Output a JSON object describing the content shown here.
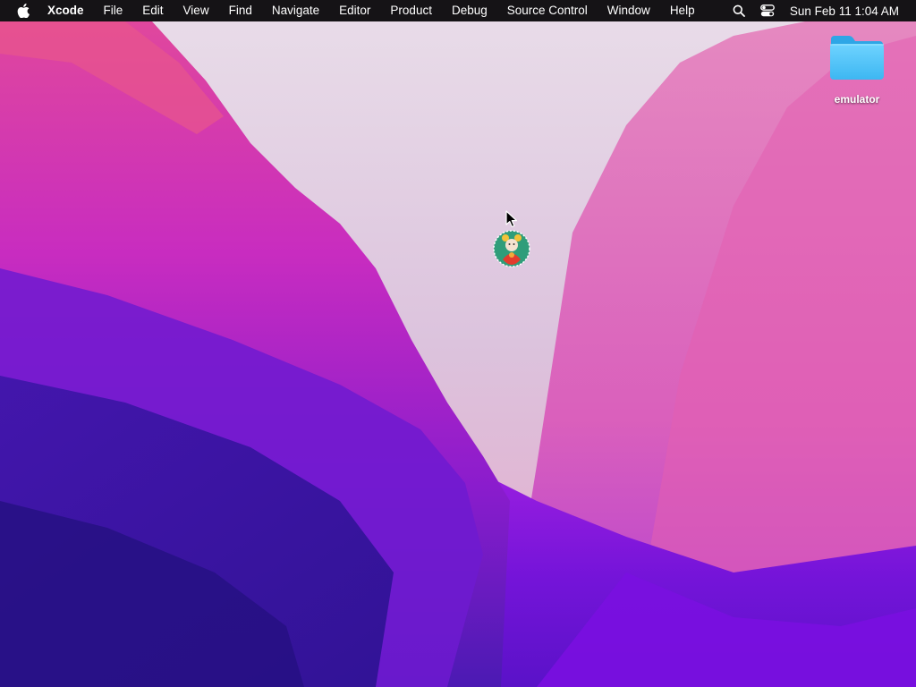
{
  "menubar": {
    "app_name": "Xcode",
    "items": [
      {
        "label": "File"
      },
      {
        "label": "Edit"
      },
      {
        "label": "View"
      },
      {
        "label": "Find"
      },
      {
        "label": "Navigate"
      },
      {
        "label": "Editor"
      },
      {
        "label": "Product"
      },
      {
        "label": "Debug"
      },
      {
        "label": "Source Control"
      },
      {
        "label": "Window"
      },
      {
        "label": "Help"
      }
    ],
    "status": {
      "icons": [
        "search-icon",
        "control-center-icon"
      ],
      "clock": "Sun Feb 11  1:04 AM"
    }
  },
  "desktop": {
    "icons": [
      {
        "label": "emulator",
        "icon": "folder-icon",
        "color": "#5ac8fa"
      }
    ]
  },
  "colors": {
    "menubar_bg": "#151316",
    "wallpaper_pink": "#e53fb1",
    "wallpaper_purple": "#6a1ad8",
    "wallpaper_light": "#e6d7ea"
  }
}
